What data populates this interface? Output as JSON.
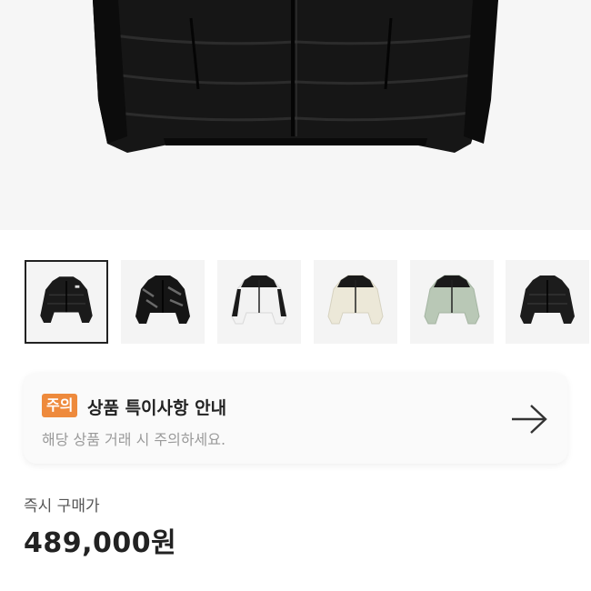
{
  "hero": {
    "image": "black-puffer-jacket-photo"
  },
  "thumbnails": [
    {
      "name": "black-puffer-jacket",
      "selected": true
    },
    {
      "name": "shiny-black-puffer-jacket",
      "selected": false
    },
    {
      "name": "white-black-puffer-jacket",
      "selected": false
    },
    {
      "name": "cream-black-puffer-jacket",
      "selected": false
    },
    {
      "name": "sage-black-puffer-jacket",
      "selected": false
    },
    {
      "name": "black-puffer-jacket-alt",
      "selected": false
    }
  ],
  "notice": {
    "badge": "주의",
    "title": "상품 특이사항 안내",
    "subtitle": "해당 상품 거래 시 주의하세요.",
    "badge_color": "#ee8a3c"
  },
  "price": {
    "label": "즉시 구매가",
    "value": "489,000원"
  }
}
